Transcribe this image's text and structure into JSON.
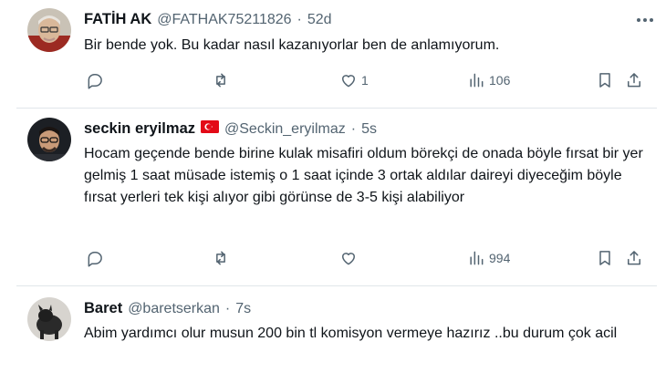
{
  "tweets": [
    {
      "name": "FATİH AK",
      "handle": "@FATHAK75211826",
      "sep": "·",
      "time": "52d",
      "text": "Bir bende yok. Bu kadar nasıl kazanıyorlar ben de anlamıyorum.",
      "likes": "1",
      "views": "106"
    },
    {
      "name": "seckin eryilmaz",
      "handle": "@Seckin_eryilmaz",
      "sep": "·",
      "time": "5s",
      "text": "Hocam geçende bende birine kulak misafiri oldum börekçi de onada böyle fırsat bir yer gelmiş 1 saat müsade istemiş o 1 saat içinde 3 ortak aldılar daireyi diyeceğim böyle fırsat yerleri tek kişi alıyor gibi görünse de 3-5 kişi alabiliyor",
      "views": "994"
    },
    {
      "name": "Baret",
      "handle": "@baretserkan",
      "sep": "·",
      "time": "7s",
      "text": "Abim yardımcı olur musun 200 bin tl komisyon vermeye hazırız ..bu durum çok acil"
    }
  ],
  "icons": {
    "reply": "reply-icon",
    "repost": "repost-icon",
    "like": "heart-icon",
    "views": "views-icon",
    "bookmark": "bookmark-icon",
    "share": "share-icon",
    "more": "more-icon",
    "flag": "turkey-flag-icon"
  },
  "colors": {
    "text": "#0f1419",
    "secondary": "#536471",
    "divider": "#e1e6ea",
    "flag": "#e30a17"
  }
}
